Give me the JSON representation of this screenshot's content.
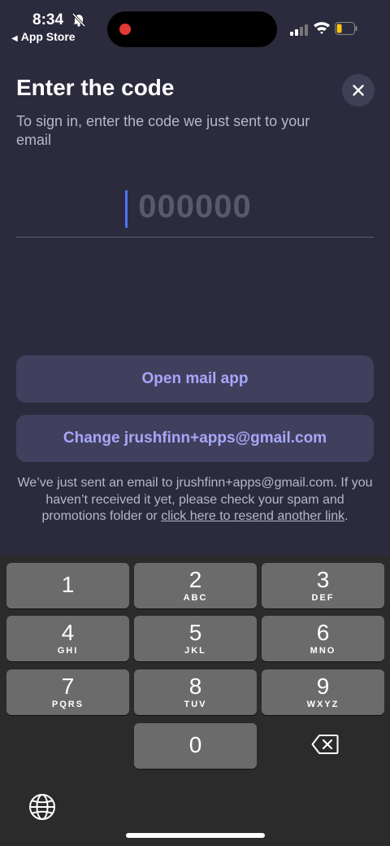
{
  "status_bar": {
    "time": "8:34",
    "back_app": "App Store",
    "icons": [
      "bell-slash-icon",
      "recording-dot-icon",
      "cellular-signal-icon",
      "wifi-icon",
      "battery-icon"
    ]
  },
  "header": {
    "title": "Enter the code",
    "subtitle": "To sign in, enter the code we just sent to your email",
    "close_icon": "close-icon"
  },
  "code_input": {
    "placeholder": "000000",
    "value": ""
  },
  "buttons": {
    "open_mail": "Open mail app",
    "change_email": "Change jrushfinn+apps@gmail.com"
  },
  "info": {
    "text_before": "We’ve just sent an email to jrushfinn+apps@gmail.com. If you haven’t received it yet, please check your spam and promotions folder or ",
    "resend_link": "click here to resend another link",
    "text_after": "."
  },
  "keyboard": {
    "keys": [
      {
        "num": "1",
        "letters": ""
      },
      {
        "num": "2",
        "letters": "ABC"
      },
      {
        "num": "3",
        "letters": "DEF"
      },
      {
        "num": "4",
        "letters": "GHI"
      },
      {
        "num": "5",
        "letters": "JKL"
      },
      {
        "num": "6",
        "letters": "MNO"
      },
      {
        "num": "7",
        "letters": "PQRS"
      },
      {
        "num": "8",
        "letters": "TUV"
      },
      {
        "num": "9",
        "letters": "WXYZ"
      },
      {
        "num": "0",
        "letters": ""
      }
    ],
    "icons": [
      "delete-backward-icon",
      "globe-icon"
    ]
  },
  "colors": {
    "background": "#2b2b3d",
    "accent": "#a7a6f8",
    "button_bg": "#40405e",
    "caret": "#4d74ff",
    "key_bg": "#6b6b6b"
  }
}
